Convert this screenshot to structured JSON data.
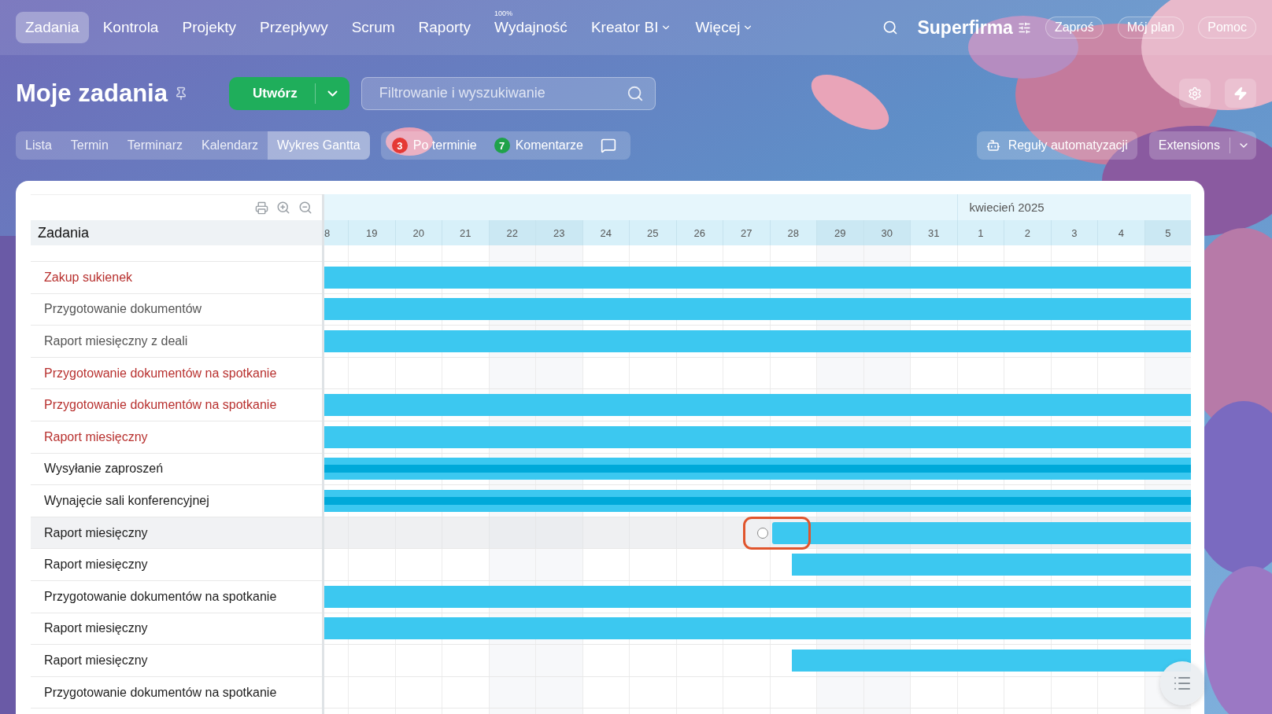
{
  "top_nav": {
    "items": [
      {
        "label": "Zadania",
        "selected": true,
        "dropdown": false
      },
      {
        "label": "Kontrola",
        "selected": false,
        "dropdown": false
      },
      {
        "label": "Projekty",
        "selected": false,
        "dropdown": false
      },
      {
        "label": "Przepływy",
        "selected": false,
        "dropdown": false
      },
      {
        "label": "Scrum",
        "selected": false,
        "dropdown": false
      },
      {
        "label": "Raporty",
        "selected": false,
        "dropdown": false
      },
      {
        "label": "Wydajność",
        "selected": false,
        "dropdown": false,
        "badge": "100%"
      },
      {
        "label": "Kreator BI",
        "selected": false,
        "dropdown": true
      },
      {
        "label": "Więcej",
        "selected": false,
        "dropdown": true
      }
    ],
    "company": "Superfirma",
    "buttons": [
      "Zaproś",
      "Mój plan",
      "Pomoc"
    ]
  },
  "page_title": "Moje zadania",
  "create_button": "Utwórz",
  "search": {
    "placeholder": "Filtrowanie i wyszukiwanie"
  },
  "view_tabs": [
    {
      "label": "Lista",
      "selected": false
    },
    {
      "label": "Termin",
      "selected": false
    },
    {
      "label": "Terminarz",
      "selected": false
    },
    {
      "label": "Kalendarz",
      "selected": false
    },
    {
      "label": "Wykres Gantta",
      "selected": true
    }
  ],
  "counters": [
    {
      "count": "3",
      "label": "Po terminie",
      "color": "#e53935"
    },
    {
      "count": "7",
      "label": "Komentarze",
      "color": "#1fa24a"
    }
  ],
  "automation_button": "Reguły automatyzacji",
  "extensions_button": "Extensions",
  "gantt": {
    "column_header": "Zadania",
    "days": [
      {
        "label": "8",
        "weekend": false
      },
      {
        "label": "19",
        "weekend": false
      },
      {
        "label": "20",
        "weekend": false
      },
      {
        "label": "21",
        "weekend": false
      },
      {
        "label": "22",
        "weekend": true
      },
      {
        "label": "23",
        "weekend": true
      },
      {
        "label": "24",
        "weekend": false
      },
      {
        "label": "25",
        "weekend": false
      },
      {
        "label": "26",
        "weekend": false
      },
      {
        "label": "27",
        "weekend": false
      },
      {
        "label": "28",
        "weekend": false
      },
      {
        "label": "29",
        "weekend": true
      },
      {
        "label": "30",
        "weekend": true
      },
      {
        "label": "31",
        "weekend": false
      },
      {
        "label": "1",
        "weekend": false,
        "month": "kwiecień 2025"
      },
      {
        "label": "2",
        "weekend": false
      },
      {
        "label": "3",
        "weekend": false
      },
      {
        "label": "4",
        "weekend": false
      },
      {
        "label": "5",
        "weekend": true
      }
    ],
    "tasks": [
      {
        "title": "Zakup sukienek",
        "overdue": true,
        "dimmed": false,
        "selected": false,
        "kind": "full"
      },
      {
        "title": "Przygotowanie dokumentów",
        "overdue": false,
        "dimmed": true,
        "selected": false,
        "kind": "full"
      },
      {
        "title": "Raport miesięczny z deali",
        "overdue": false,
        "dimmed": true,
        "selected": false,
        "kind": "full"
      },
      {
        "title": "Przygotowanie dokumentów na spotkanie",
        "overdue": true,
        "dimmed": false,
        "selected": false,
        "kind": "none"
      },
      {
        "title": "Przygotowanie dokumentów na spotkanie",
        "overdue": true,
        "dimmed": false,
        "selected": false,
        "kind": "full"
      },
      {
        "title": "Raport miesięczny",
        "overdue": true,
        "dimmed": false,
        "selected": false,
        "kind": "full"
      },
      {
        "title": "Wysyłanie zaproszeń",
        "overdue": false,
        "dimmed": false,
        "selected": false,
        "kind": "summary"
      },
      {
        "title": "Wynajęcie sali konferencyjnej",
        "overdue": false,
        "dimmed": false,
        "selected": false,
        "kind": "summary"
      },
      {
        "title": "Raport miesięczny",
        "overdue": false,
        "dimmed": false,
        "selected": true,
        "kind": "marked"
      },
      {
        "title": "Raport miesięczny",
        "overdue": false,
        "dimmed": false,
        "selected": false,
        "kind": "partial"
      },
      {
        "title": "Przygotowanie dokumentów na spotkanie",
        "overdue": false,
        "dimmed": false,
        "selected": false,
        "kind": "full"
      },
      {
        "title": "Raport miesięczny",
        "overdue": false,
        "dimmed": false,
        "selected": false,
        "kind": "full"
      },
      {
        "title": "Raport miesięczny",
        "overdue": false,
        "dimmed": false,
        "selected": false,
        "kind": "partial"
      },
      {
        "title": "Przygotowanie dokumentów na spotkanie",
        "overdue": false,
        "dimmed": false,
        "selected": false,
        "kind": "none"
      }
    ]
  }
}
